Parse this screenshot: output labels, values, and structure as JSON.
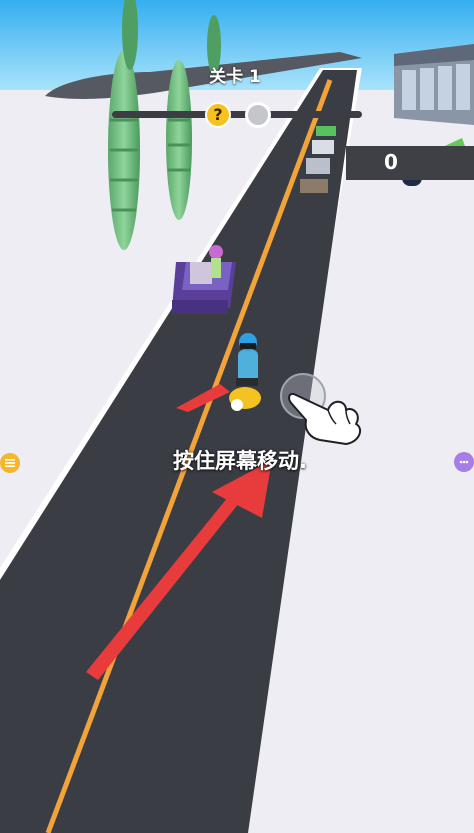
{
  "hud": {
    "level_label": "关卡 1",
    "bonus_stage_symbol": "?",
    "progress_fraction": 0.0
  },
  "wallet": {
    "money_count": "0",
    "icon": "cash-stack-icon"
  },
  "side_buttons": {
    "left_icon": "menu-list-icon",
    "right_icon": "more-games-icon"
  },
  "tutorial": {
    "text": "按住屏幕移动.",
    "hand_icon": "pointing-hand-icon",
    "arrow_icon": "swipe-arrow-icon"
  },
  "colors": {
    "sky": "#41b9f2",
    "road": "#3b3d45",
    "lane_line": "#f2a43a",
    "accent_yellow": "#f7c21e",
    "arrow_red": "#e83b3b"
  }
}
